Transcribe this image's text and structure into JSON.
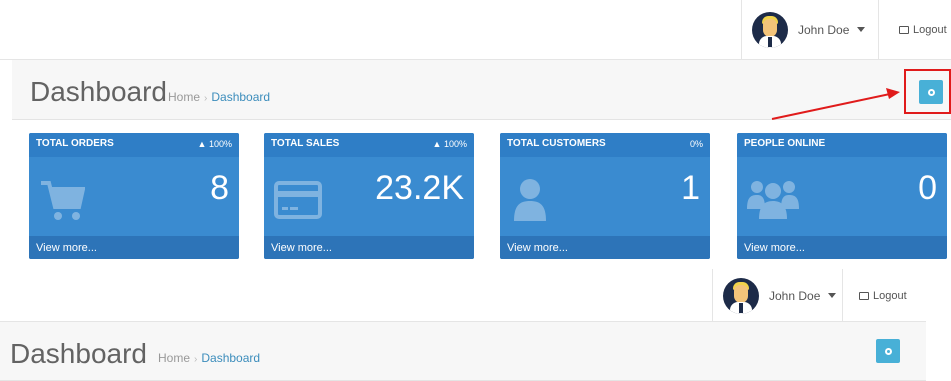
{
  "top_section": {
    "user": {
      "name": "John Doe"
    },
    "logout_label": "Logout",
    "page_title": "Dashboard",
    "breadcrumb": [
      "Home",
      "Dashboard"
    ]
  },
  "tiles": [
    {
      "title": "TOTAL ORDERS",
      "percent": "100%",
      "trend": "up",
      "value": "8",
      "icon": "cart-icon",
      "footer": "View more..."
    },
    {
      "title": "TOTAL SALES",
      "percent": "100%",
      "trend": "up",
      "value": "23.2K",
      "icon": "credit-card-icon",
      "footer": "View more..."
    },
    {
      "title": "TOTAL CUSTOMERS",
      "percent": "0%",
      "trend": "none",
      "value": "1",
      "icon": "user-icon",
      "footer": "View more..."
    },
    {
      "title": "PEOPLE ONLINE",
      "percent": "",
      "trend": "none",
      "value": "0",
      "icon": "users-icon",
      "footer": "View more..."
    }
  ],
  "bottom_section": {
    "user": {
      "name": "John Doe"
    },
    "logout_label": "Logout",
    "page_title": "Dashboard",
    "breadcrumb": [
      "Home",
      "Dashboard"
    ]
  },
  "colors": {
    "tile_bg": "#3a8bd0",
    "tile_header": "#2f7ec6",
    "gear_button": "#48b0d7",
    "annotation": "#e01b1b",
    "breadcrumb_link": "#3c8dbc"
  }
}
